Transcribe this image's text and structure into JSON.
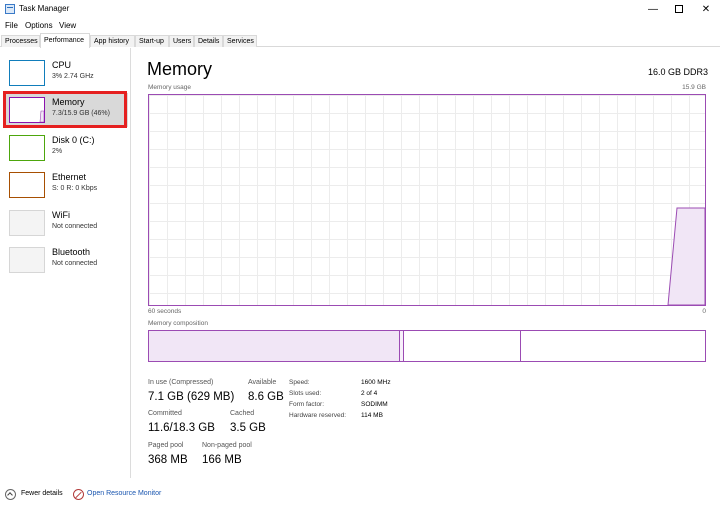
{
  "window": {
    "title": "Task Manager",
    "minimize": "—",
    "close": "✕"
  },
  "menu": [
    "File",
    "Options",
    "View"
  ],
  "tabs": [
    "Processes",
    "Performance",
    "App history",
    "Start-up",
    "Users",
    "Details",
    "Services"
  ],
  "active_tab": "Performance",
  "sidebar": {
    "items": [
      {
        "name": "CPU",
        "sub": "3% 2.74 GHz",
        "color": "#117dbb"
      },
      {
        "name": "Memory",
        "sub": "7.3/15.9 GB (46%)",
        "color": "#8b12ae"
      },
      {
        "name": "Disk 0 (C:)",
        "sub": "2%",
        "color": "#4da60c"
      },
      {
        "name": "Ethernet",
        "sub": "S: 0 R: 0 Kbps",
        "color": "#a74f01"
      },
      {
        "name": "WiFi",
        "sub": "Not connected",
        "color": "#d6d6d6"
      },
      {
        "name": "Bluetooth",
        "sub": "Not connected",
        "color": "#d6d6d6"
      }
    ]
  },
  "main": {
    "title": "Memory",
    "spec": "16.0 GB DDR3",
    "usage_label": "Memory usage",
    "usage_max": "15.9 GB",
    "x_left": "60 seconds",
    "x_right": "0",
    "composition_label": "Memory composition",
    "accent": "#9b4bb3",
    "usage_fraction": 0.46
  },
  "stats": {
    "in_use_label": "In use (Compressed)",
    "in_use": "7.1 GB (629 MB)",
    "available_label": "Available",
    "available": "8.6 GB",
    "committed_label": "Committed",
    "committed": "11.6/18.3 GB",
    "cached_label": "Cached",
    "cached": "3.5 GB",
    "paged_label": "Paged pool",
    "paged": "368 MB",
    "nonpaged_label": "Non-paged pool",
    "nonpaged": "166 MB"
  },
  "hardware": {
    "speed_label": "Speed:",
    "speed": "1600 MHz",
    "slots_label": "Slots used:",
    "slots": "2 of 4",
    "form_label": "Form factor:",
    "form": "SODIMM",
    "reserved_label": "Hardware reserved:",
    "reserved": "114 MB"
  },
  "footer": {
    "fewer": "Fewer details",
    "monitor": "Open Resource Monitor"
  }
}
